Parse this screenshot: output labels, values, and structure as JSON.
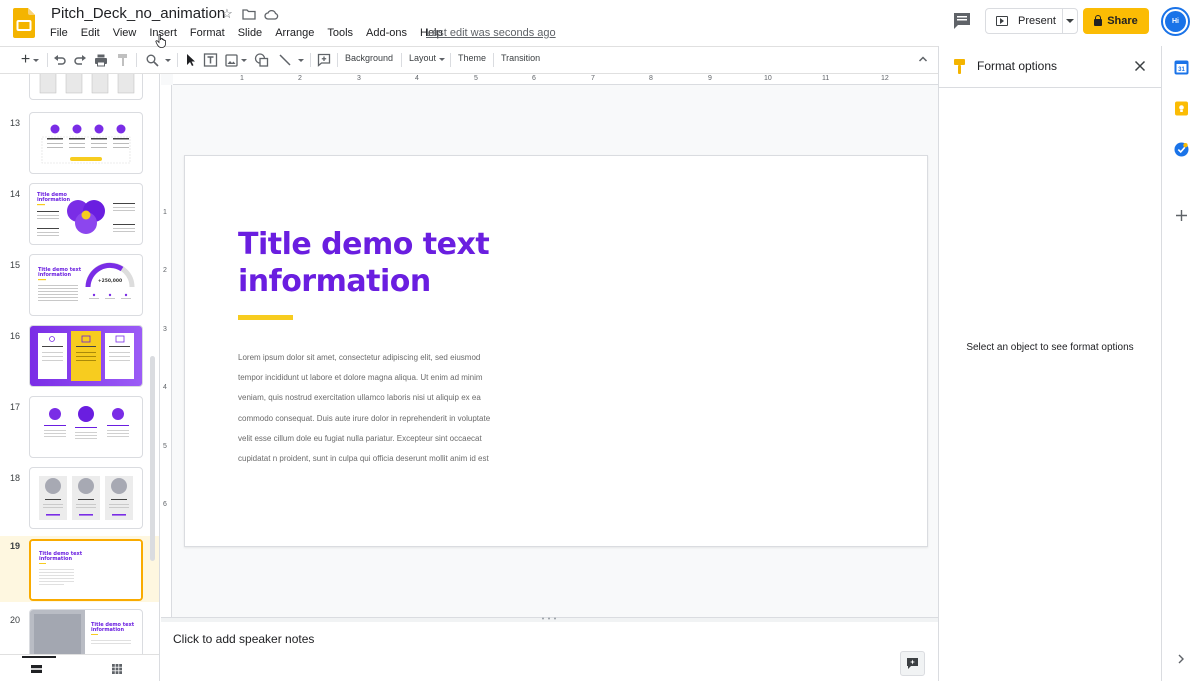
{
  "header": {
    "doc_title": "Pitch_Deck_no_animation",
    "menu": [
      "File",
      "Edit",
      "View",
      "Insert",
      "Format",
      "Slide",
      "Arrange",
      "Tools",
      "Add-ons",
      "Help"
    ],
    "last_edit": "Last edit was seconds ago",
    "present_label": "Present",
    "share_label": "Share",
    "avatar_initials": "Hi"
  },
  "toolbar": {
    "background_label": "Background",
    "layout_label": "Layout",
    "theme_label": "Theme",
    "transition_label": "Transition"
  },
  "ruler": {
    "horizontal": [
      "1",
      "2",
      "3",
      "4",
      "5",
      "6",
      "7",
      "8",
      "9",
      "10",
      "11",
      "12"
    ],
    "vertical": [
      "1",
      "2",
      "3",
      "4",
      "5",
      "6"
    ]
  },
  "filmstrip": {
    "slides": [
      {
        "number": "13"
      },
      {
        "number": "14",
        "thumb_title": "Title demo information"
      },
      {
        "number": "15",
        "thumb_title": "Title demo text information",
        "thumb_stat": "+250,000"
      },
      {
        "number": "16"
      },
      {
        "number": "17"
      },
      {
        "number": "18"
      },
      {
        "number": "19",
        "thumb_title": "Title demo text information"
      },
      {
        "number": "20",
        "thumb_title": "Title demo text information"
      }
    ],
    "selected": "19"
  },
  "slide": {
    "title": "Title demo text information",
    "body": "Lorem ipsum dolor sit amet, consectetur adipiscing elit, sed eiusmod tempor incididunt ut labore et dolore magna aliqua. Ut enim ad minim veniam, quis nostrud exercitation ullamco laboris nisi ut aliquip ex ea commodo consequat. Duis aute irure dolor in reprehenderit in voluptate velit esse cillum dole eu fugiat nulla pariatur. Excepteur sint occaecat cupidatat n proident, sunt in culpa qui officia deserunt mollit anim id est",
    "colors": {
      "title": "#6a1ee0",
      "accent_bar": "#f7cc1f",
      "body": "#6b6b6b"
    }
  },
  "notes": {
    "placeholder": "Click to add speaker notes"
  },
  "format_panel": {
    "title": "Format options",
    "message": "Select an object to see format options"
  },
  "icons": {
    "side_panel": [
      "calendar-icon",
      "keep-icon",
      "tasks-icon",
      "add-icon"
    ]
  }
}
